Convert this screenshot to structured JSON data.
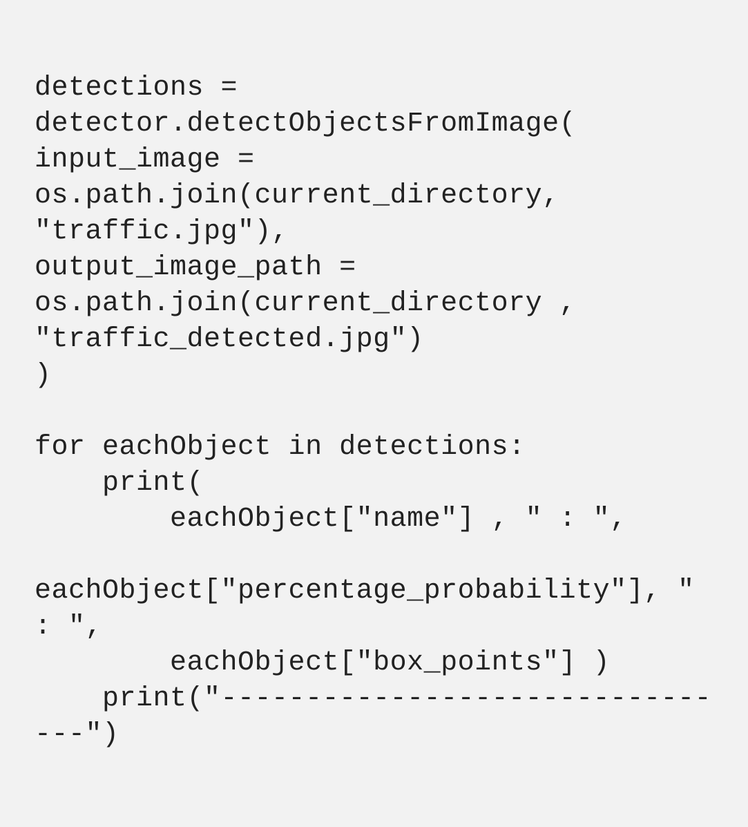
{
  "code": {
    "line1": "detections = detector.detectObjectsFromImage(",
    "line2": "input_image = os.path.join(current_directory, \"traffic.jpg\"),",
    "line3": "output_image_path = os.path.join(current_directory , \"traffic_detected.jpg\")",
    "line4": ")",
    "line5": "",
    "line6": "for eachObject in detections:",
    "line7": "    print(",
    "line8": "        eachObject[\"name\"] , \" : \",",
    "line9": "        eachObject[\"percentage_probability\"], \" : \",",
    "line10": "        eachObject[\"box_points\"] )",
    "line11": "    print(\"--------------------------------\")"
  }
}
